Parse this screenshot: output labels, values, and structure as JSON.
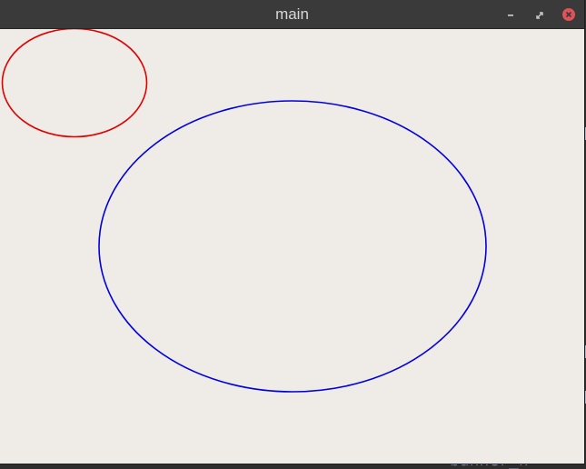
{
  "window": {
    "title": "main"
  },
  "controls": {
    "minimize_icon": "minimize-icon",
    "maximize_icon": "maximize-icon",
    "close_icon": "close-icon",
    "close_color": "#e0525a"
  },
  "shapes": [
    {
      "kind": "ellipse",
      "name": "red-ellipse",
      "stroke": "#e00000"
    },
    {
      "kind": "ellipse",
      "name": "blue-ellipse",
      "stroke": "#0000e0"
    }
  ],
  "background": {
    "partial_text": "banner_n"
  }
}
